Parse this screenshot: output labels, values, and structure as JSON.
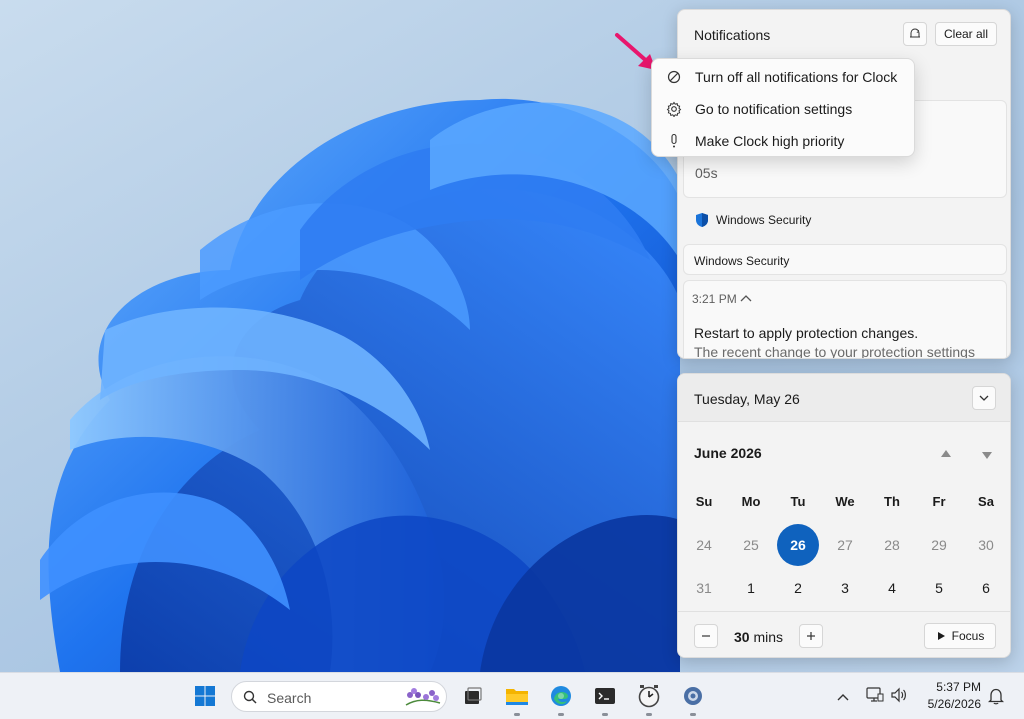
{
  "notifications": {
    "title": "Notifications",
    "clear_all": "Clear all",
    "clock_partial_text": "05s",
    "security_app": "Windows Security",
    "security_group_title": "Windows Security",
    "security_time": "3:21 PM",
    "security_headline": "Restart to apply protection changes.",
    "security_body": "The recent change to your protection settings"
  },
  "context_menu": {
    "items": [
      {
        "label": "Turn off all notifications for Clock",
        "icon": "block-icon"
      },
      {
        "label": "Go to notification settings",
        "icon": "gear-icon"
      },
      {
        "label": "Make Clock high priority",
        "icon": "exclamation-icon"
      }
    ]
  },
  "calendar": {
    "date_header": "Tuesday, May 26",
    "month_label": "June 2026",
    "weekdays": [
      "Su",
      "Mo",
      "Tu",
      "We",
      "Th",
      "Fr",
      "Sa"
    ],
    "week1": [
      "24",
      "25",
      "26",
      "27",
      "28",
      "29",
      "30"
    ],
    "week2": [
      "31",
      "1",
      "2",
      "3",
      "4",
      "5",
      "6"
    ],
    "selected_day": "26",
    "accent": "#0f62be"
  },
  "focus": {
    "minutes": "30",
    "unit": "mins",
    "button": "Focus"
  },
  "taskbar": {
    "search_placeholder": "Search",
    "time": "5:37 PM",
    "date": "5/26/2026",
    "apps": [
      "start-icon",
      "task-view-icon",
      "file-explorer-icon",
      "edge-icon",
      "terminal-icon",
      "clock-app-icon",
      "settings-icon"
    ]
  },
  "colors": {
    "accent": "#0f62be",
    "arrow": "#e8166d"
  }
}
